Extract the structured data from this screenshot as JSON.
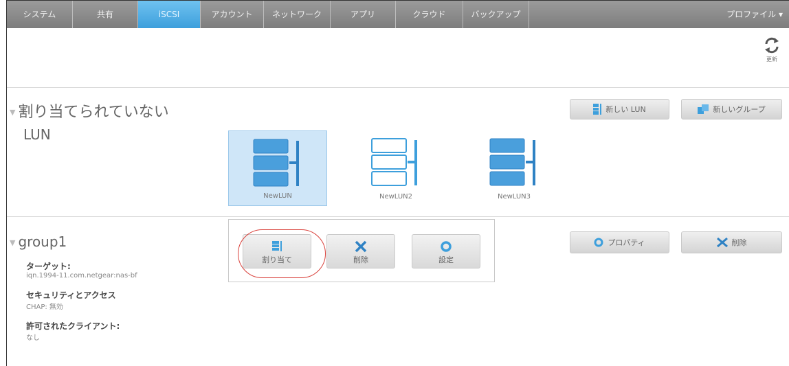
{
  "nav": {
    "tabs": [
      {
        "label": "システム"
      },
      {
        "label": "共有"
      },
      {
        "label": "iSCSI"
      },
      {
        "label": "アカウント"
      },
      {
        "label": "ネットワーク"
      },
      {
        "label": "アプリ"
      },
      {
        "label": "クラウド"
      },
      {
        "label": "バックアップ"
      }
    ],
    "active_tab": "iSCSI",
    "profile": "プロファイル ▾"
  },
  "toolbar": {
    "refresh_label": "更新"
  },
  "unassigned": {
    "title_line1": "割り当てられていない",
    "title_line2": "LUN",
    "new_lun_button": "新しい LUN",
    "new_group_button": "新しいグループ",
    "luns": [
      {
        "name": "NewLUN",
        "selected": true,
        "style": "filled"
      },
      {
        "name": "NewLUN2",
        "selected": false,
        "style": "outline"
      },
      {
        "name": "NewLUN3",
        "selected": false,
        "style": "filled"
      }
    ]
  },
  "popup": {
    "assign_label": "割り当て",
    "delete_label": "削除",
    "settings_label": "設定"
  },
  "group": {
    "title": "group1",
    "properties_button": "プロパティ",
    "delete_button": "削除",
    "target_label": "ターゲット:",
    "target_value": "iqn.1994-11.com.netgear:nas-bf",
    "security_label": "セキュリティとアクセス",
    "security_value": "CHAP: 無効",
    "clients_label": "許可されたクライアント:",
    "clients_value": "なし"
  },
  "colors": {
    "accent": "#3d9fdc",
    "highlight_ring": "#d9413b",
    "lun_fill": "#4a9fdc"
  }
}
